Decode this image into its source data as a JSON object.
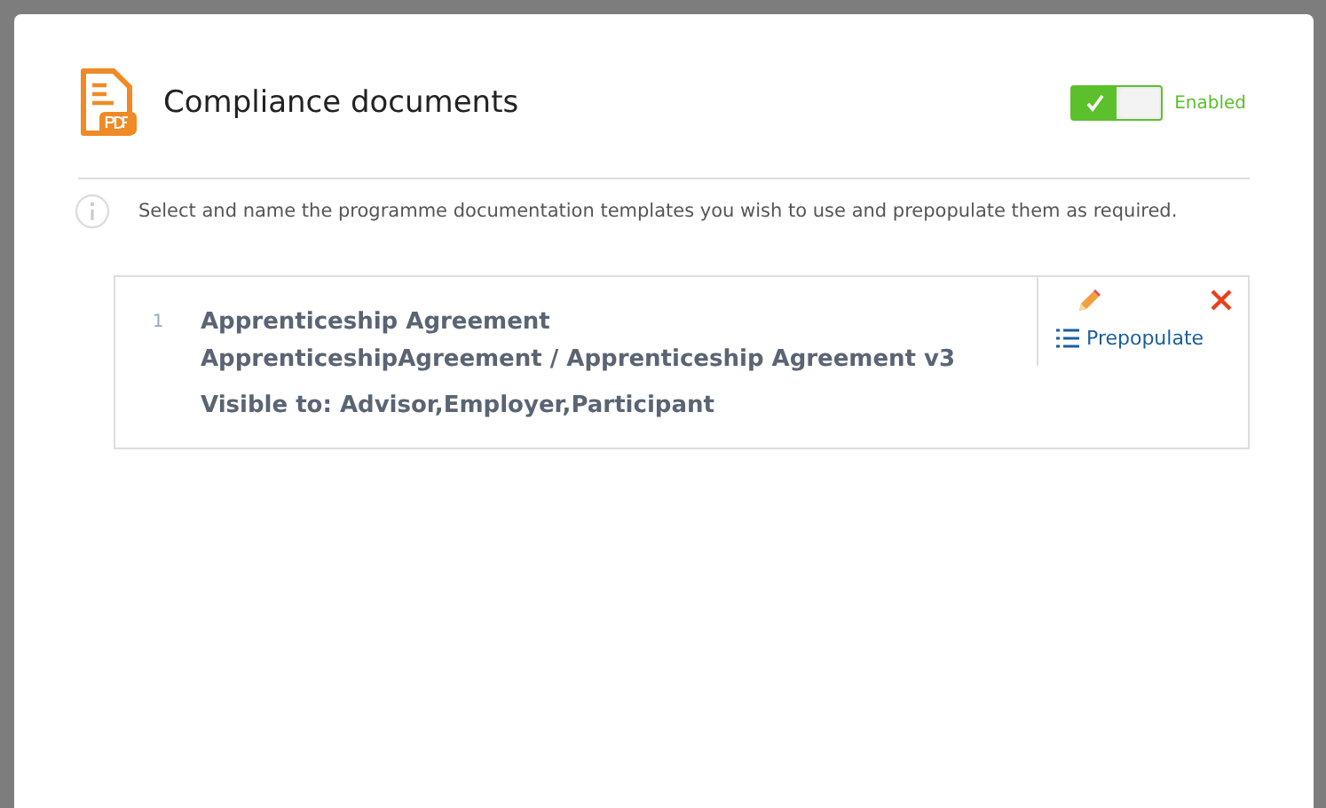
{
  "dialog": {
    "title": "Compliance documents",
    "toggle": {
      "on": true,
      "label": "Enabled"
    },
    "info": "Select and name the programme documentation templates you wish to use and prepopulate them as required.",
    "documents": [
      {
        "number": "1",
        "title": "Apprenticeship Agreement",
        "template": "ApprenticeshipAgreement / Apprenticeship Agreement v3",
        "visibility": "Visible to: Advisor,Employer,Participant",
        "action": "Prepopulate"
      }
    ]
  }
}
